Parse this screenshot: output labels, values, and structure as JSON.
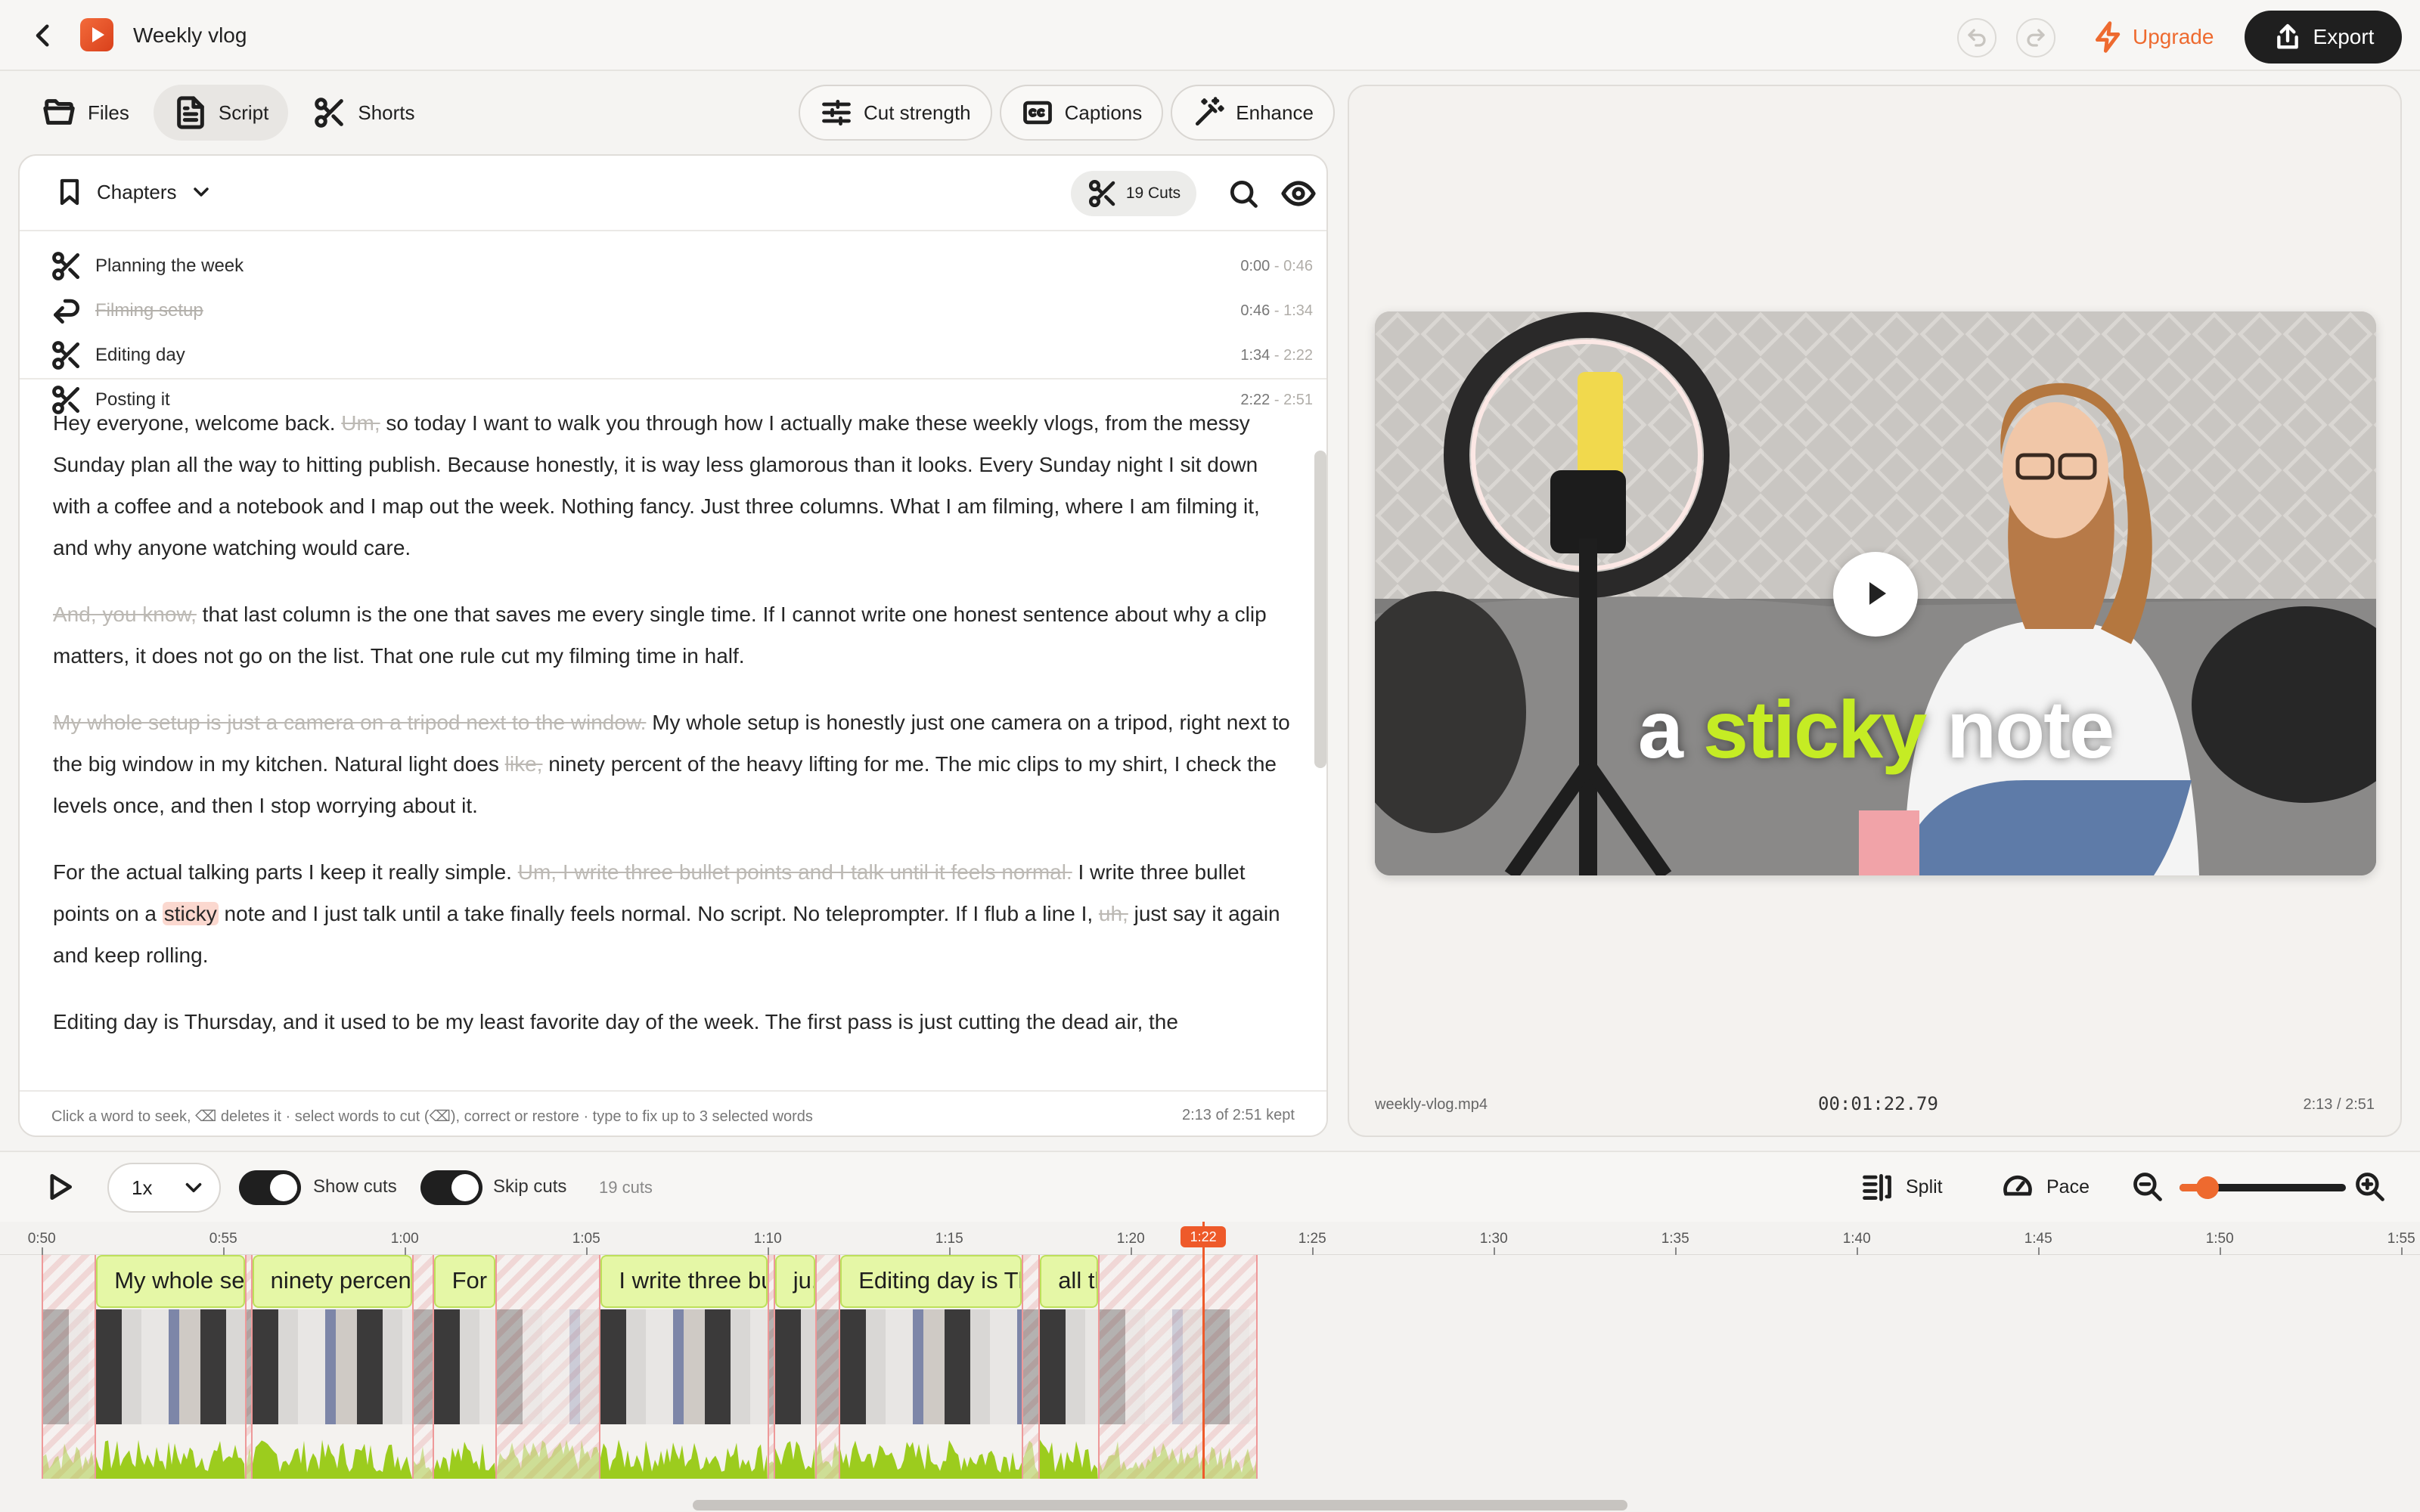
{
  "topbar": {
    "title": "Weekly vlog",
    "upgrade": "Upgrade",
    "export": "Export"
  },
  "tabs": [
    {
      "label": "Files",
      "icon": "folder-icon"
    },
    {
      "label": "Script",
      "icon": "document-icon"
    },
    {
      "label": "Shorts",
      "icon": "scissors-icon"
    }
  ],
  "tools": [
    {
      "label": "Cut strength",
      "icon": "sliders-icon"
    },
    {
      "label": "Captions",
      "icon": "captions-icon"
    },
    {
      "label": "Enhance",
      "icon": "magic-wand-icon"
    }
  ],
  "script": {
    "chapters_label": "Chapters",
    "cuts_badge": "19 Cuts",
    "chapters": [
      {
        "name": "Planning the week",
        "start": "0:00",
        "end": "0:46",
        "cut": false
      },
      {
        "name": "Filming setup",
        "start": "0:46",
        "end": "1:34",
        "cut": true
      },
      {
        "name": "Editing day",
        "start": "1:34",
        "end": "2:22",
        "cut": false
      },
      {
        "name": "Posting it",
        "start": "2:22",
        "end": "2:51",
        "cut": false
      }
    ],
    "paragraphs": [
      [
        {
          "t": "Hey everyone, welcome back. "
        },
        {
          "t": "Um,",
          "d": true
        },
        {
          "t": " so today I want to walk you through how I actually make these weekly vlogs, from the messy Sunday plan all the way to hitting publish. Because honestly, it is way less glamorous than it looks. Every Sunday night I sit down with a coffee and a notebook and I map out the week. Nothing fancy. Just three columns. What I am filming, where I am filming it, and why anyone watching would care."
        }
      ],
      [
        {
          "t": "And, you know,",
          "d": true
        },
        {
          "t": " that last column is the one that saves me every single time. If I cannot write one honest sentence about why a clip matters, it does not go on the list. That one rule cut my filming time in half."
        }
      ],
      [
        {
          "t": "My whole setup is just a camera on a tripod next to the window.",
          "d": true
        },
        {
          "t": " My whole setup is honestly just one camera on a tripod, right next to the big window in my kitchen. Natural light does "
        },
        {
          "t": "like,",
          "d": true
        },
        {
          "t": " ninety percent of the heavy lifting for me. The mic clips to my shirt, I check the levels once, and then I stop worrying about it."
        }
      ],
      [
        {
          "t": "For the actual talking parts I keep it really simple. "
        },
        {
          "t": "Um, I write three bullet points and I talk until it feels normal.",
          "d": true
        },
        {
          "t": " I write three bullet points on a "
        },
        {
          "t": "sticky",
          "h": true
        },
        {
          "t": " note and I just talk until a take finally feels normal. No script. No teleprompter. If I flub a line I, "
        },
        {
          "t": "uh,",
          "d": true
        },
        {
          "t": " just say it again and keep rolling."
        }
      ],
      [
        {
          "t": "Editing day is Thursday, and it used to be my least favorite day of the week. The first pass is just cutting the dead air, the"
        }
      ]
    ],
    "hint": "Click a word to seek, ⌫ deletes it · select words to cut (⌫), correct or restore · type to fix up to 3 selected words",
    "kept": "2:13 of 2:51 kept"
  },
  "preview": {
    "caption_pre": "a ",
    "caption_kw": "sticky",
    "caption_post": " note",
    "file": "weekly-vlog.mp4",
    "timecode": "00:01:22.79",
    "duration": "2:13 / 2:51"
  },
  "controls": {
    "speed": "1x",
    "show_cuts": "Show cuts",
    "skip_cuts": "Skip cuts",
    "cuts_count": "19 cuts",
    "split": "Split",
    "pace": "Pace"
  },
  "timeline": {
    "ticks": [
      "0:50",
      "0:55",
      "1:00",
      "1:05",
      "1:10",
      "1:15",
      "1:20",
      "1:25",
      "1:30",
      "1:35",
      "1:40",
      "1:45",
      "1:50",
      "1:55"
    ],
    "playhead": "1:22",
    "segments": [
      {
        "kind": "cut",
        "from": 50.0,
        "to": 51.5
      },
      {
        "kind": "kept",
        "from": 51.5,
        "to": 55.6,
        "label": "My whole setup is h..."
      },
      {
        "kind": "cut",
        "from": 55.6,
        "to": 55.8
      },
      {
        "kind": "kept",
        "from": 55.8,
        "to": 60.2,
        "label": "ninety percent of the h..."
      },
      {
        "kind": "cut",
        "from": 60.2,
        "to": 60.8
      },
      {
        "kind": "kept",
        "from": 60.8,
        "to": 62.5,
        "label": "For th..."
      },
      {
        "kind": "cut",
        "from": 62.5,
        "to": 65.4
      },
      {
        "kind": "kept",
        "from": 65.4,
        "to": 70.0,
        "label": "I write three bullet points o..."
      },
      {
        "kind": "cut",
        "from": 70.0,
        "to": 70.2
      },
      {
        "kind": "kept",
        "from": 70.2,
        "to": 71.3,
        "label": "ju..."
      },
      {
        "kind": "cut",
        "from": 71.3,
        "to": 72.0
      },
      {
        "kind": "kept",
        "from": 72.0,
        "to": 77.0,
        "label": "Editing day is Thursday, a..."
      },
      {
        "kind": "cut",
        "from": 77.0,
        "to": 77.5
      },
      {
        "kind": "kept",
        "from": 77.5,
        "to": 79.1,
        "label": "all th..."
      },
      {
        "kind": "cut",
        "from": 79.1,
        "to": 83.5
      }
    ]
  }
}
